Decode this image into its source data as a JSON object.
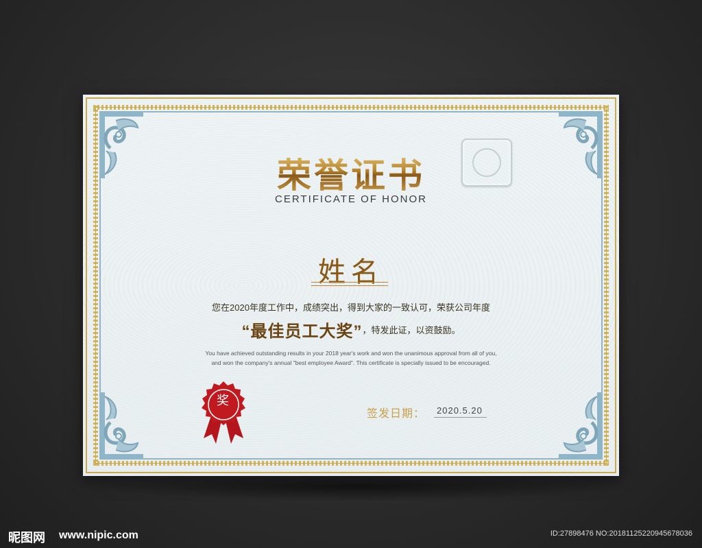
{
  "certificate": {
    "title_cn": "荣誉证书",
    "title_en": "CERTIFICATE OF HONOR",
    "name_placeholder": "姓名",
    "body_cn": "您在2020年度工作中，成绩突出，得到大家的一致认可，荣获公司年度",
    "award_name": "“最佳员工大奖”",
    "award_suffix": "，特发此证，以资鼓励。",
    "body_en_line1": "You have achieved outstanding results in your 2018 year's work and won the unanimous approval from all of you,",
    "body_en_line2": "and won the company's annual \"best employee Award\". This certificate is specially issued to be encouraged.",
    "date_label": "签发日期：",
    "date_value": "2020.5.20",
    "seal_text": "奖"
  },
  "watermark": {
    "site_logo": "昵图网",
    "site_url": "www.nipic.com",
    "image_id": "ID:27898476 NO:20181125220945678036"
  },
  "colors": {
    "background": "#2a2a2a",
    "paper": "#eef3f4",
    "gold": "#c9a94a",
    "blue_border": "#8fb6c8",
    "seal_red": "#c0191f"
  }
}
